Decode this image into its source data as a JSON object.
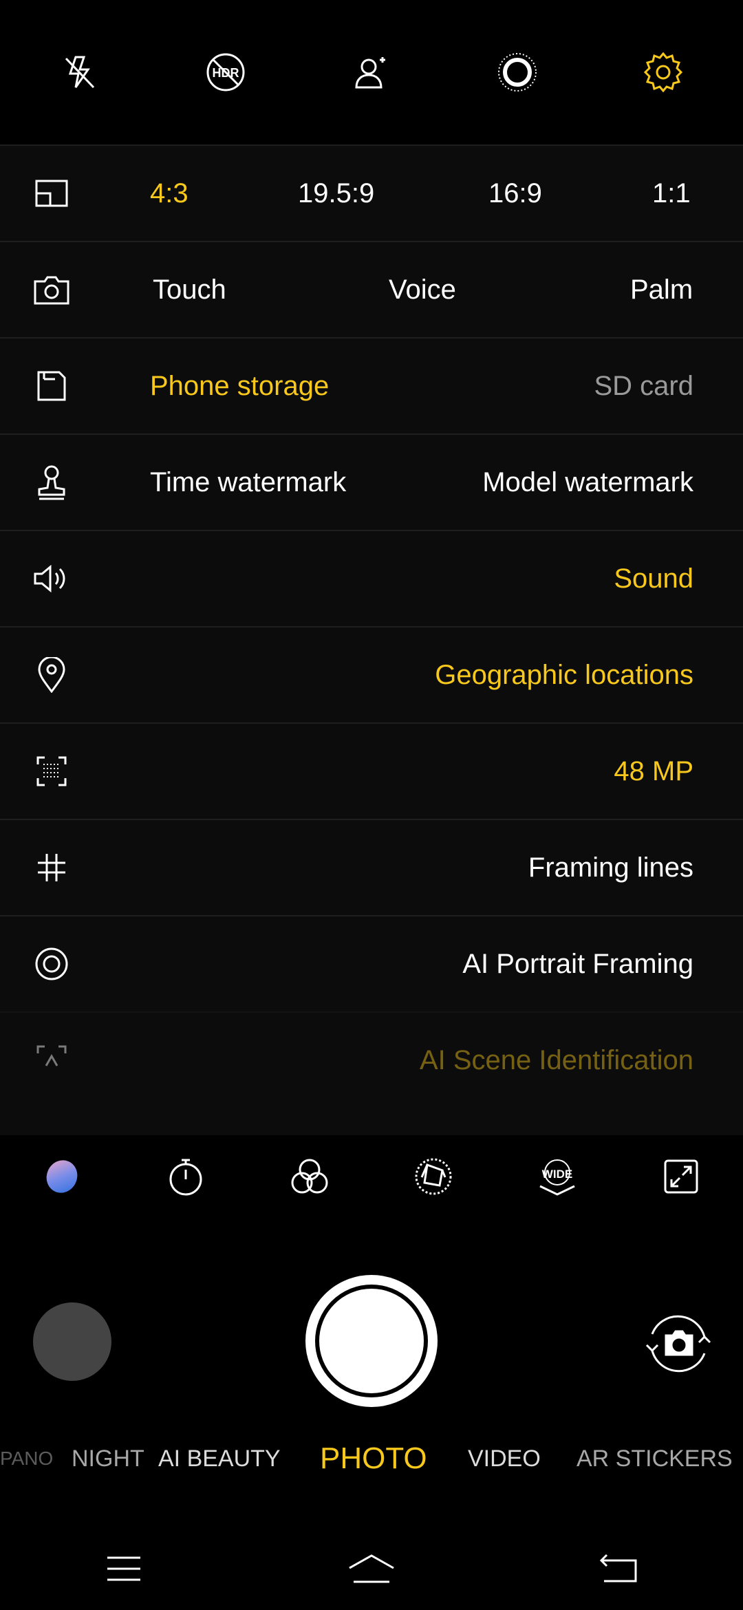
{
  "topbar": {
    "icons": [
      "flash-off-icon",
      "hdr-off-icon",
      "face-beauty-icon",
      "live-photo-icon",
      "settings-gear-icon"
    ],
    "settings_color": "#f8c91c"
  },
  "settings": {
    "aspect_ratio": {
      "options": [
        "4:3",
        "19.5:9",
        "16:9",
        "1:1"
      ],
      "selected": "4:3"
    },
    "capture": {
      "options": [
        "Touch",
        "Voice",
        "Palm"
      ]
    },
    "storage": {
      "options": [
        "Phone storage",
        "SD card"
      ],
      "selected": "Phone storage"
    },
    "watermark": {
      "options": [
        "Time watermark",
        "Model watermark"
      ]
    },
    "sound": {
      "label": "Sound"
    },
    "location": {
      "label": "Geographic locations"
    },
    "resolution": {
      "label": "48 MP"
    },
    "grid": {
      "label": "Framing lines"
    },
    "portrait": {
      "label": "AI Portrait Framing"
    },
    "scene": {
      "label": "AI Scene Identification"
    }
  },
  "tools": {
    "icons": [
      "color-filter-blob-icon",
      "timer-icon",
      "filters-icon",
      "aperture-icon",
      "wide-angle-icon",
      "expand-icon"
    ]
  },
  "modes": {
    "items": [
      "PANO",
      "NIGHT",
      "AI BEAUTY",
      "PHOTO",
      "VIDEO",
      "AR STICKERS"
    ],
    "selected": "PHOTO"
  },
  "colors": {
    "accent": "#f8c91c",
    "background": "#000000",
    "panel": "#0c0c0c"
  }
}
